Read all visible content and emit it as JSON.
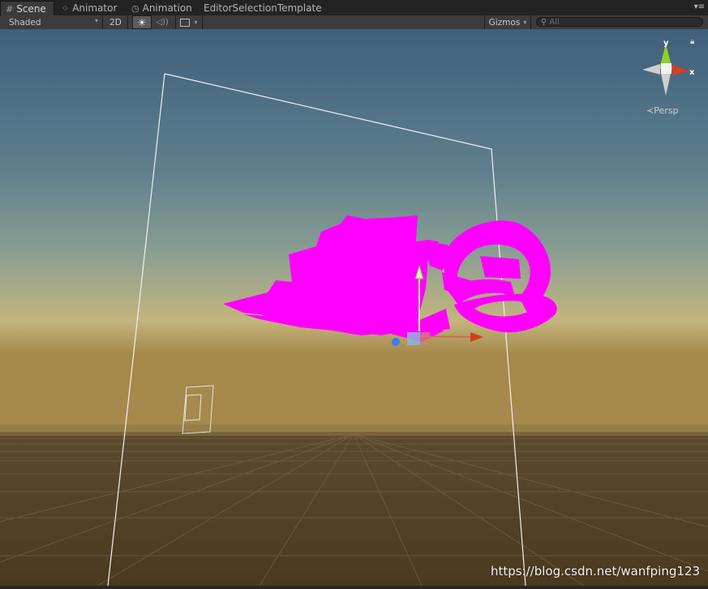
{
  "tabs": [
    {
      "label": "Scene",
      "icon": "scene-grid-icon"
    },
    {
      "label": "Animator",
      "icon": "animator-icon"
    },
    {
      "label": "Animation",
      "icon": "animation-clock-icon"
    },
    {
      "label": "EditorSelectionTemplate",
      "icon": ""
    }
  ],
  "toolbar": {
    "shading_mode": "Shaded",
    "mode_2d": "2D",
    "gizmos_label": "Gizmos",
    "search_placeholder": "All"
  },
  "scene": {
    "orientation_axes": {
      "y": "y",
      "x": "x"
    },
    "projection_label": "Persp",
    "axis_colors": {
      "x": "#e03b1d",
      "y": "#8fd127",
      "z": "#3c7ef0"
    },
    "object_color": "#ff00ff"
  },
  "watermark": "https://blog.csdn.net/wanfping123"
}
